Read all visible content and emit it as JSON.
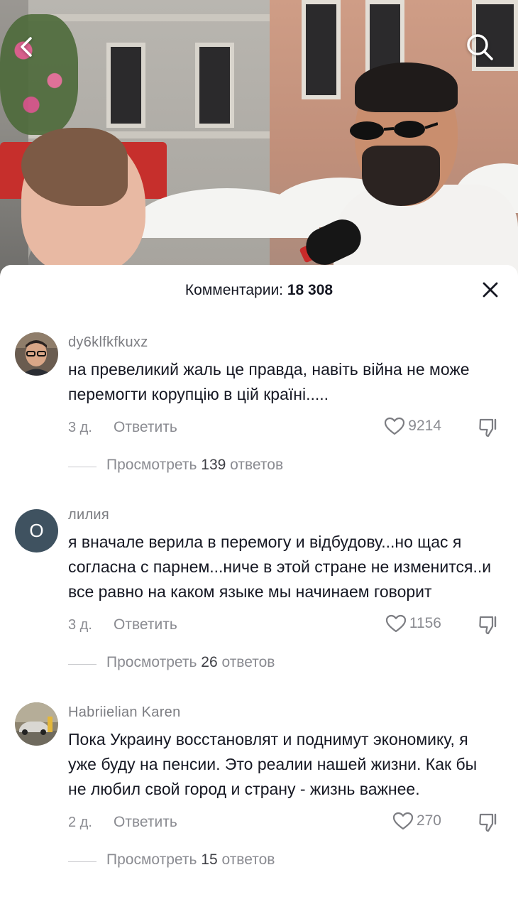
{
  "sheet": {
    "title_prefix": "Комментарии: ",
    "count": "18 308"
  },
  "comments": [
    {
      "username": "dy6klfkfkuxz",
      "avatar": "photo-man-glasses",
      "text": "на превеликий жаль це правда, навіть війна не може перемогти корупцію в цій країні.....",
      "age": "3 д.",
      "reply_label": "Ответить",
      "likes": "9214",
      "view_replies_prefix": "Просмотреть ",
      "reply_count": "139",
      "view_replies_suffix": " ответов"
    },
    {
      "username": "лилия",
      "avatar_letter": "О",
      "text": "я вначале верила в перемогу и відбудову...но щас я согласна с парнем...ниче в этой стране не изменится..и все равно на каком языке мы начинаем говорит",
      "age": "3 д.",
      "reply_label": "Ответить",
      "likes": "1156",
      "view_replies_prefix": "Просмотреть ",
      "reply_count": "26",
      "view_replies_suffix": " ответов"
    },
    {
      "username": "Habriielian Karen",
      "avatar": "photo-car",
      "text": "Пока Украину восстановлят и поднимут экономику, я уже буду на пенсии. Это реалии нашей жизни. Как бы не любил свой город и страну - жизнь важнее.",
      "age": "2 д.",
      "reply_label": "Ответить",
      "likes": "270",
      "view_replies_prefix": "Просмотреть ",
      "reply_count": "15",
      "view_replies_suffix": " ответов"
    }
  ],
  "icons": {
    "back": "chevron-left-icon",
    "search": "search-icon",
    "close": "close-icon",
    "like": "heart-outline-icon",
    "dislike": "thumbs-down-icon"
  },
  "colors": {
    "text_primary": "#161823",
    "text_secondary": "#8a8b91",
    "avatar_letter_bg": "#3f5260"
  }
}
